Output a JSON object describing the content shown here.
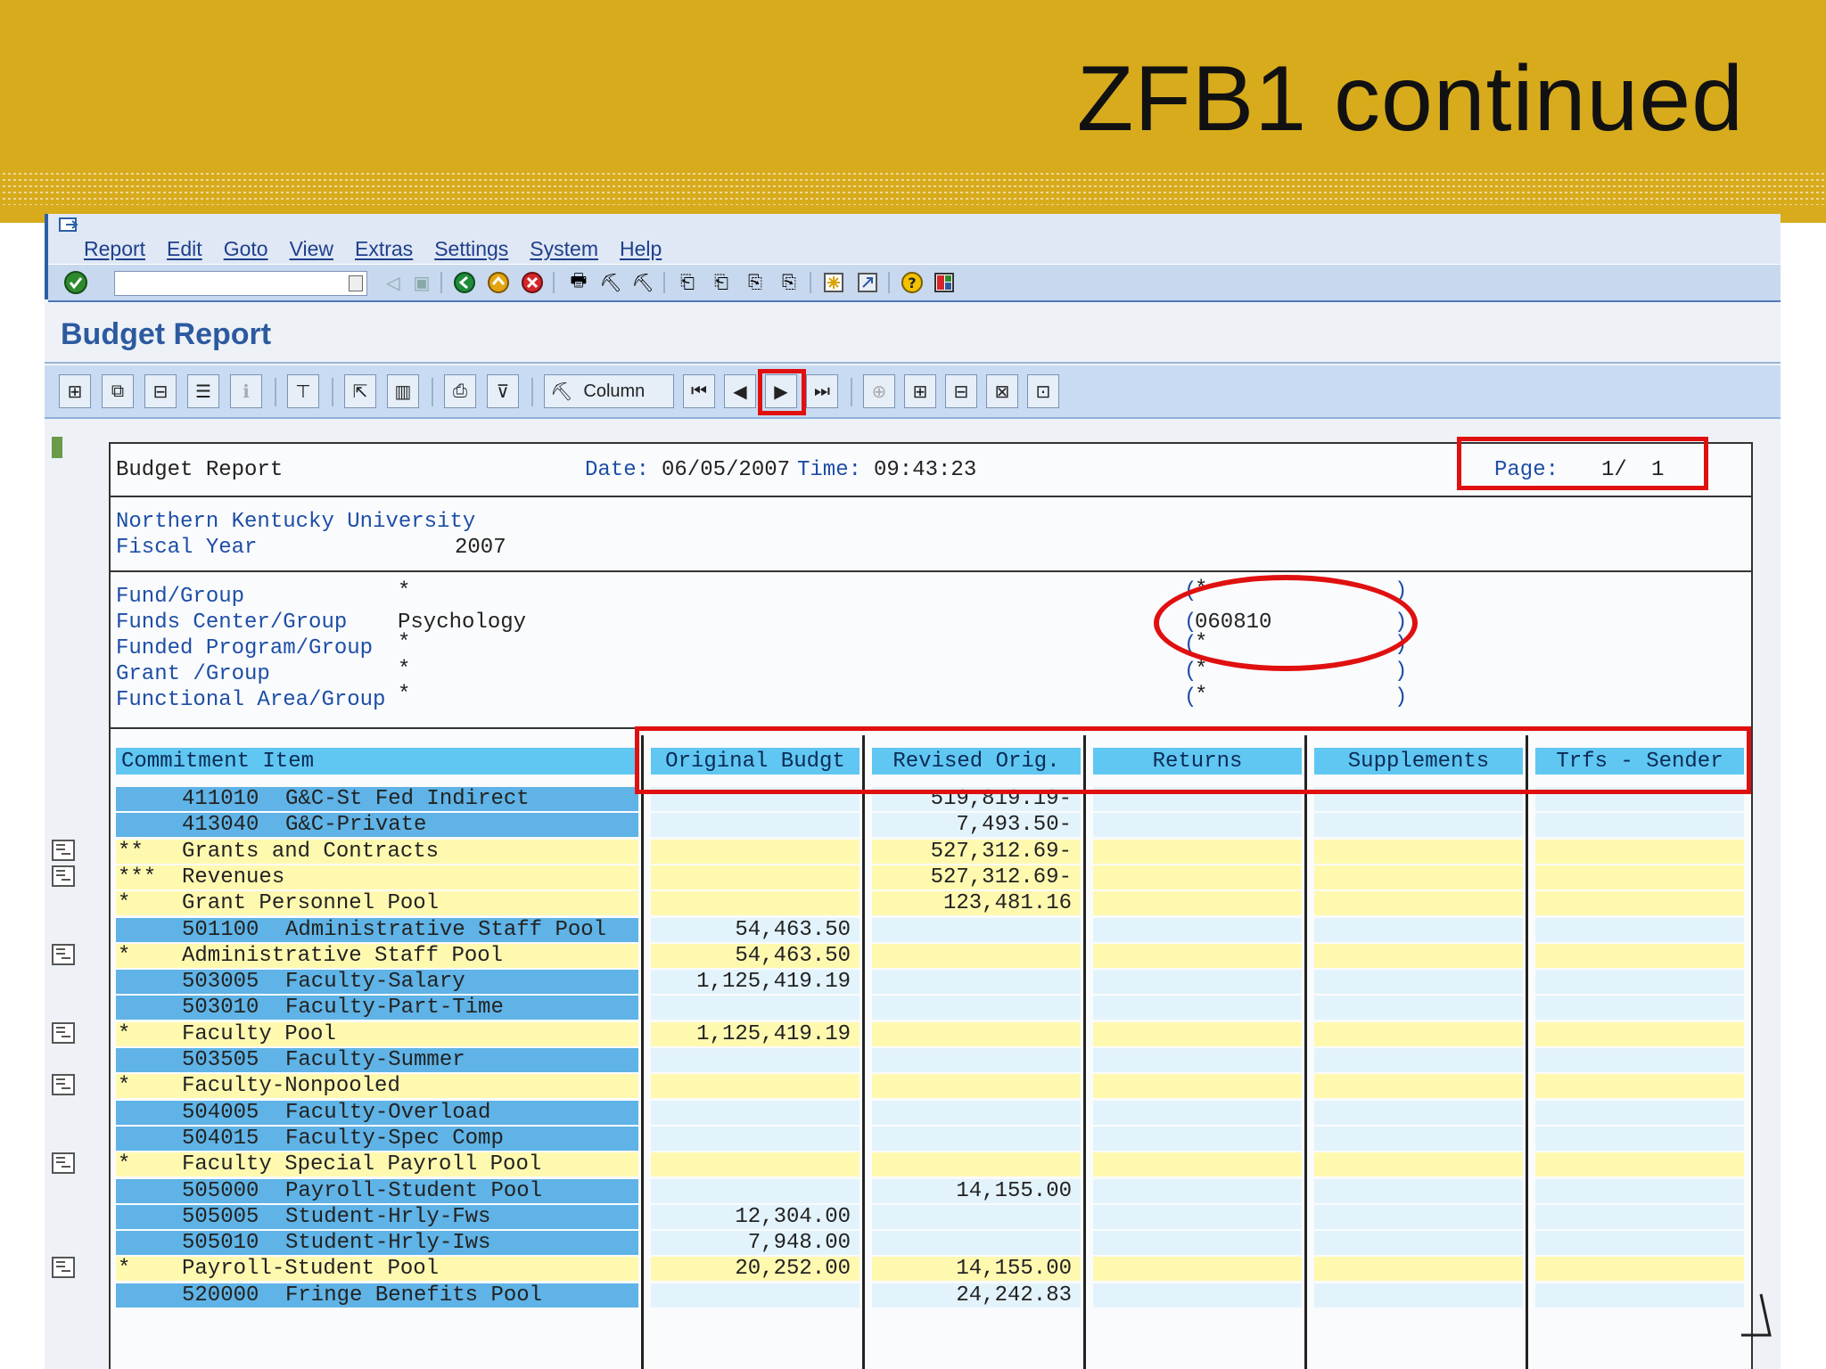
{
  "slide": {
    "title": "ZFB1 continued"
  },
  "sap": {
    "menu": [
      "Report",
      "Edit",
      "Goto",
      "View",
      "Extras",
      "Settings",
      "System",
      "Help"
    ],
    "app_title": "Budget Report",
    "toolbar": {
      "column_label": "Column"
    }
  },
  "report": {
    "title": "Budget Report",
    "date_label": "Date:",
    "date": "06/05/2007",
    "time_label": "Time:",
    "time": "09:43:23",
    "page_label": "Page:",
    "page": "1/",
    "page_total": "1",
    "org": "Northern Kentucky University",
    "fiscal_year_label": "Fiscal Year",
    "fiscal_year": "2007",
    "selections": [
      {
        "label": "Fund/Group",
        "value": "*",
        "paren": "*"
      },
      {
        "label": "Funds Center/Group",
        "value": "Psychology",
        "paren": "060810"
      },
      {
        "label": "Funded Program/Group",
        "value": "*",
        "paren": "*"
      },
      {
        "label": "Grant /Group",
        "value": "*",
        "paren": "*"
      },
      {
        "label": "Functional Area/Group",
        "value": "*",
        "paren": "*"
      }
    ],
    "columns": [
      "Commitment Item",
      "Original Budgt",
      "Revised Orig.",
      "Returns",
      "Supplements",
      "Trfs - Sender"
    ],
    "rows": [
      {
        "level": "",
        "code": "411010",
        "name": "G&C-St Fed Indirect",
        "orig": "",
        "revised": "519,819.19-",
        "summary": false,
        "icon": false
      },
      {
        "level": "",
        "code": "413040",
        "name": "G&C-Private",
        "orig": "",
        "revised": "7,493.50-",
        "summary": false,
        "icon": false
      },
      {
        "level": "**",
        "code": "",
        "name": "Grants and Contracts",
        "orig": "",
        "revised": "527,312.69-",
        "summary": true,
        "icon": true
      },
      {
        "level": "***",
        "code": "",
        "name": "Revenues",
        "orig": "",
        "revised": "527,312.69-",
        "summary": true,
        "icon": true
      },
      {
        "level": "*",
        "code": "",
        "name": "Grant Personnel Pool",
        "orig": "",
        "revised": "123,481.16",
        "summary": true,
        "icon": false
      },
      {
        "level": "",
        "code": "501100",
        "name": "Administrative Staff Pool",
        "orig": "54,463.50",
        "revised": "",
        "summary": false,
        "icon": false
      },
      {
        "level": "*",
        "code": "",
        "name": "Administrative Staff Pool",
        "orig": "54,463.50",
        "revised": "",
        "summary": true,
        "icon": true
      },
      {
        "level": "",
        "code": "503005",
        "name": "Faculty-Salary",
        "orig": "1,125,419.19",
        "revised": "",
        "summary": false,
        "icon": false
      },
      {
        "level": "",
        "code": "503010",
        "name": "Faculty-Part-Time",
        "orig": "",
        "revised": "",
        "summary": false,
        "icon": false
      },
      {
        "level": "*",
        "code": "",
        "name": "Faculty Pool",
        "orig": "1,125,419.19",
        "revised": "",
        "summary": true,
        "icon": true
      },
      {
        "level": "",
        "code": "503505",
        "name": "Faculty-Summer",
        "orig": "",
        "revised": "",
        "summary": false,
        "icon": false
      },
      {
        "level": "*",
        "code": "",
        "name": "Faculty-Nonpooled",
        "orig": "",
        "revised": "",
        "summary": true,
        "icon": true
      },
      {
        "level": "",
        "code": "504005",
        "name": "Faculty-Overload",
        "orig": "",
        "revised": "",
        "summary": false,
        "icon": false
      },
      {
        "level": "",
        "code": "504015",
        "name": "Faculty-Spec Comp",
        "orig": "",
        "revised": "",
        "summary": false,
        "icon": false
      },
      {
        "level": "*",
        "code": "",
        "name": "Faculty Special Payroll Pool",
        "orig": "",
        "revised": "",
        "summary": true,
        "icon": true
      },
      {
        "level": "",
        "code": "505000",
        "name": "Payroll-Student Pool",
        "orig": "",
        "revised": "14,155.00",
        "summary": false,
        "icon": false
      },
      {
        "level": "",
        "code": "505005",
        "name": "Student-Hrly-Fws",
        "orig": "12,304.00",
        "revised": "",
        "summary": false,
        "icon": false
      },
      {
        "level": "",
        "code": "505010",
        "name": "Student-Hrly-Iws",
        "orig": "7,948.00",
        "revised": "",
        "summary": false,
        "icon": false
      },
      {
        "level": "*",
        "code": "",
        "name": "Payroll-Student Pool",
        "orig": "20,252.00",
        "revised": "14,155.00",
        "summary": true,
        "icon": true
      },
      {
        "level": "",
        "code": "520000",
        "name": "Fringe Benefits Pool",
        "orig": "",
        "revised": "24,242.83",
        "summary": false,
        "icon": false
      }
    ],
    "colors": {
      "item_bg": "#5fb3e6",
      "summary_bg": "#fff9b0",
      "detail_cell_bg": "#e3f3fb",
      "highlight": "#e01010"
    }
  }
}
